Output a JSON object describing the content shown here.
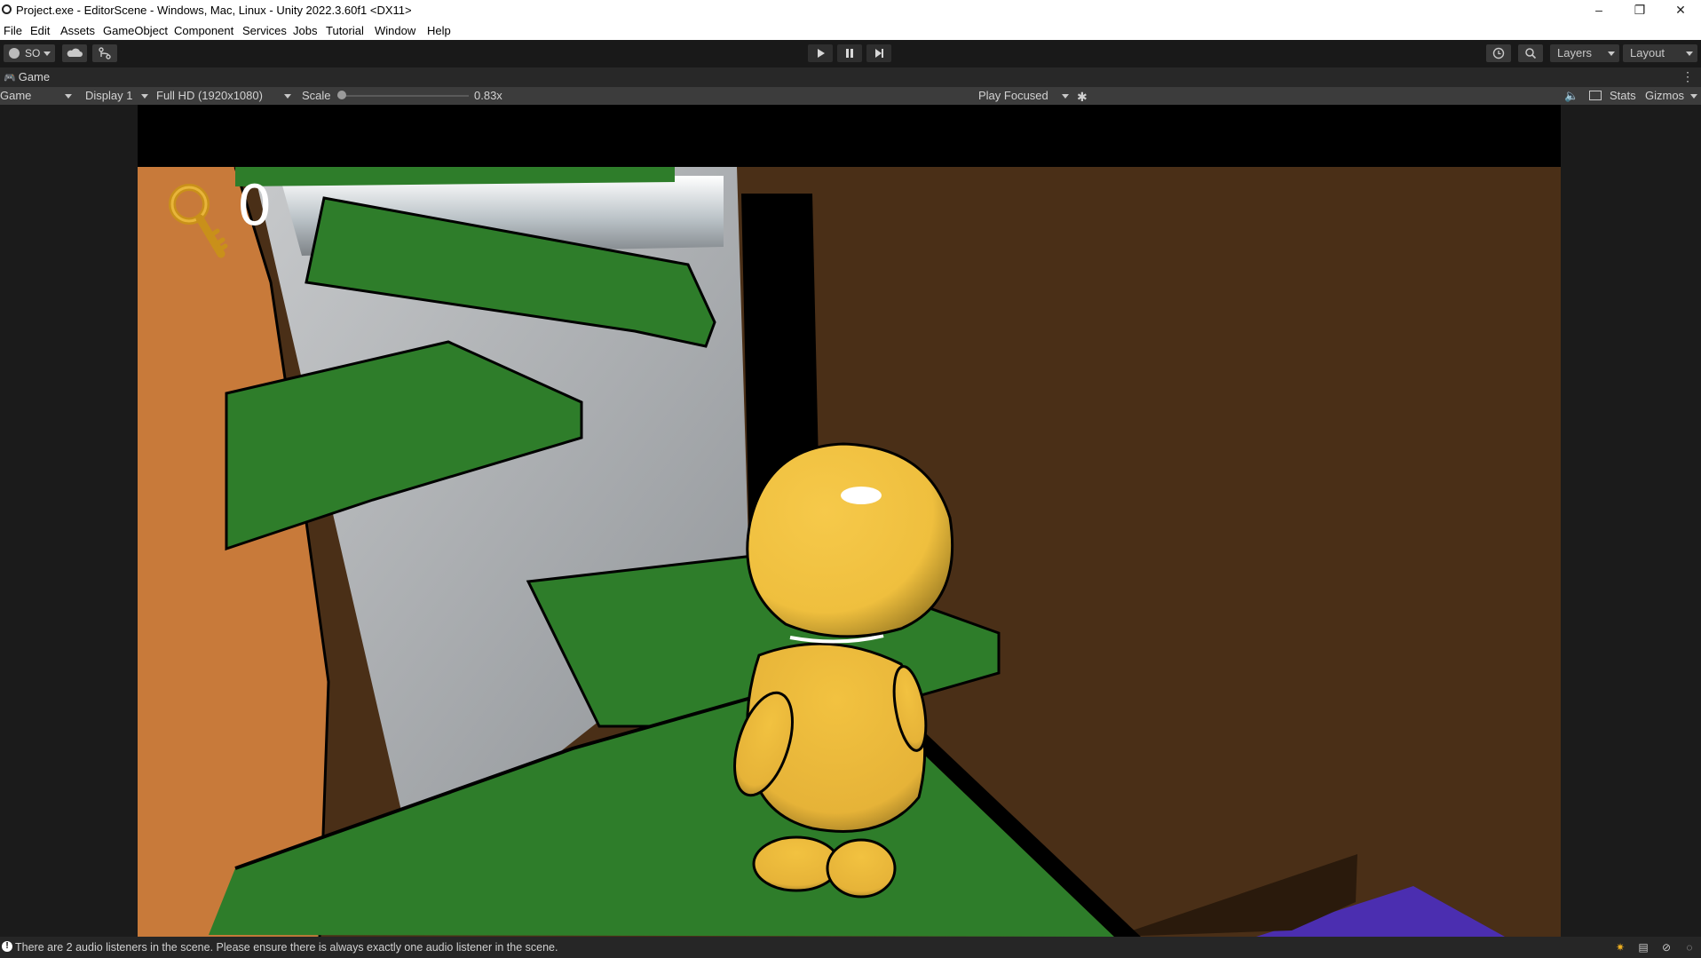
{
  "window": {
    "title": "Project.exe - EditorScene - Windows, Mac, Linux - Unity 2022.3.60f1 <DX11>",
    "controls": {
      "minimize": "–",
      "maximize": "❐",
      "close": "✕"
    }
  },
  "menu": {
    "items": [
      "File",
      "Edit",
      "Assets",
      "GameObject",
      "Component",
      "Services",
      "Jobs",
      "Tutorial",
      "Window",
      "Help"
    ]
  },
  "toolbar": {
    "account_label": "SO",
    "layers_label": "Layers",
    "layout_label": "Layout"
  },
  "tab": {
    "label": "Game"
  },
  "game_controls": {
    "mode": "Game",
    "display": "Display 1",
    "resolution": "Full HD (1920x1080)",
    "scale_label": "Scale",
    "scale_value": "0.83x",
    "scale_fraction": 0.0,
    "play_mode": "Play Focused",
    "stats_label": "Stats",
    "gizmos_label": "Gizmos"
  },
  "hud": {
    "key_count": "0"
  },
  "status": {
    "message": "There are 2 audio listeners in the scene. Please ensure there is always exactly one audio listener in the scene."
  },
  "colors": {
    "character": "#f0c040",
    "platform": "#2e7d2a",
    "back_wall": "#4a2f17",
    "left_wall": "#c87a3a",
    "corridor": "#9a9ea4",
    "accent_purple": "#4b2eb0"
  }
}
